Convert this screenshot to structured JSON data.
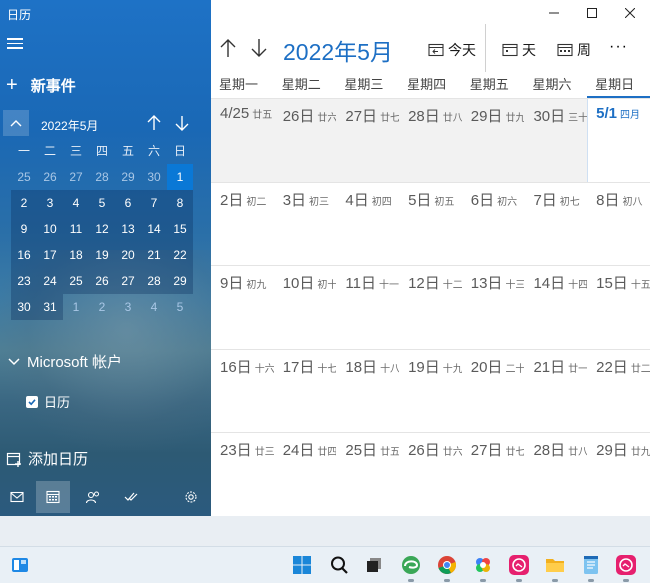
{
  "app": {
    "title": "日历"
  },
  "sidebar": {
    "new_event": "新事件",
    "mini_calendar": {
      "title": "2022年5月",
      "dow": [
        "一",
        "二",
        "三",
        "四",
        "五",
        "六",
        "日"
      ],
      "days": [
        {
          "d": "25",
          "kind": "other"
        },
        {
          "d": "26",
          "kind": "other"
        },
        {
          "d": "27",
          "kind": "other"
        },
        {
          "d": "28",
          "kind": "other"
        },
        {
          "d": "29",
          "kind": "other"
        },
        {
          "d": "30",
          "kind": "other"
        },
        {
          "d": "1",
          "kind": "today"
        },
        {
          "d": "2",
          "kind": "cur"
        },
        {
          "d": "3",
          "kind": "cur"
        },
        {
          "d": "4",
          "kind": "cur"
        },
        {
          "d": "5",
          "kind": "cur"
        },
        {
          "d": "6",
          "kind": "cur"
        },
        {
          "d": "7",
          "kind": "cur"
        },
        {
          "d": "8",
          "kind": "cur"
        },
        {
          "d": "9",
          "kind": "cur"
        },
        {
          "d": "10",
          "kind": "cur"
        },
        {
          "d": "11",
          "kind": "cur"
        },
        {
          "d": "12",
          "kind": "cur"
        },
        {
          "d": "13",
          "kind": "cur"
        },
        {
          "d": "14",
          "kind": "cur"
        },
        {
          "d": "15",
          "kind": "cur"
        },
        {
          "d": "16",
          "kind": "cur"
        },
        {
          "d": "17",
          "kind": "cur"
        },
        {
          "d": "18",
          "kind": "cur"
        },
        {
          "d": "19",
          "kind": "cur"
        },
        {
          "d": "20",
          "kind": "cur"
        },
        {
          "d": "21",
          "kind": "cur"
        },
        {
          "d": "22",
          "kind": "cur"
        },
        {
          "d": "23",
          "kind": "cur"
        },
        {
          "d": "24",
          "kind": "cur"
        },
        {
          "d": "25",
          "kind": "cur"
        },
        {
          "d": "26",
          "kind": "cur"
        },
        {
          "d": "27",
          "kind": "cur"
        },
        {
          "d": "28",
          "kind": "cur"
        },
        {
          "d": "29",
          "kind": "cur"
        },
        {
          "d": "30",
          "kind": "cur"
        },
        {
          "d": "31",
          "kind": "cur"
        },
        {
          "d": "1",
          "kind": "other"
        },
        {
          "d": "2",
          "kind": "other"
        },
        {
          "d": "3",
          "kind": "other"
        },
        {
          "d": "4",
          "kind": "other"
        },
        {
          "d": "5",
          "kind": "other"
        }
      ]
    },
    "account": "Microsoft 帐户",
    "calendar_item": "日历",
    "add_calendar": "添加日历",
    "bottom_nav": [
      "mail-icon",
      "calendar-icon",
      "people-icon",
      "todo-icon",
      "settings-icon"
    ]
  },
  "main": {
    "title": "2022年5月",
    "today_btn": "今天",
    "day_btn": "天",
    "week_btn": "周",
    "more": "···",
    "dow": [
      "星期一",
      "星期二",
      "星期三",
      "星期四",
      "星期五",
      "星期六",
      "星期日"
    ],
    "weeks": [
      [
        {
          "num": "4/25",
          "lunar": "廿五",
          "kind": "other"
        },
        {
          "num": "26日",
          "lunar": "廿六",
          "kind": "other"
        },
        {
          "num": "27日",
          "lunar": "廿七",
          "kind": "other"
        },
        {
          "num": "28日",
          "lunar": "廿八",
          "kind": "other"
        },
        {
          "num": "29日",
          "lunar": "廿九",
          "kind": "other"
        },
        {
          "num": "30日",
          "lunar": "三十",
          "kind": "other"
        },
        {
          "num": "5/1",
          "lunar": "四月",
          "kind": "today"
        }
      ],
      [
        {
          "num": "2日",
          "lunar": "初二",
          "kind": "cur"
        },
        {
          "num": "3日",
          "lunar": "初三",
          "kind": "cur"
        },
        {
          "num": "4日",
          "lunar": "初四",
          "kind": "cur"
        },
        {
          "num": "5日",
          "lunar": "初五",
          "kind": "cur"
        },
        {
          "num": "6日",
          "lunar": "初六",
          "kind": "cur"
        },
        {
          "num": "7日",
          "lunar": "初七",
          "kind": "cur"
        },
        {
          "num": "8日",
          "lunar": "初八",
          "kind": "cur"
        }
      ],
      [
        {
          "num": "9日",
          "lunar": "初九",
          "kind": "cur"
        },
        {
          "num": "10日",
          "lunar": "初十",
          "kind": "cur"
        },
        {
          "num": "11日",
          "lunar": "十一",
          "kind": "cur"
        },
        {
          "num": "12日",
          "lunar": "十二",
          "kind": "cur"
        },
        {
          "num": "13日",
          "lunar": "十三",
          "kind": "cur"
        },
        {
          "num": "14日",
          "lunar": "十四",
          "kind": "cur"
        },
        {
          "num": "15日",
          "lunar": "十五",
          "kind": "cur"
        }
      ],
      [
        {
          "num": "16日",
          "lunar": "十六",
          "kind": "cur"
        },
        {
          "num": "17日",
          "lunar": "十七",
          "kind": "cur"
        },
        {
          "num": "18日",
          "lunar": "十八",
          "kind": "cur"
        },
        {
          "num": "19日",
          "lunar": "十九",
          "kind": "cur"
        },
        {
          "num": "20日",
          "lunar": "二十",
          "kind": "cur"
        },
        {
          "num": "21日",
          "lunar": "廿一",
          "kind": "cur"
        },
        {
          "num": "22日",
          "lunar": "廿二",
          "kind": "cur"
        }
      ],
      [
        {
          "num": "23日",
          "lunar": "廿三",
          "kind": "cur"
        },
        {
          "num": "24日",
          "lunar": "廿四",
          "kind": "cur"
        },
        {
          "num": "25日",
          "lunar": "廿五",
          "kind": "cur"
        },
        {
          "num": "26日",
          "lunar": "廿六",
          "kind": "cur"
        },
        {
          "num": "27日",
          "lunar": "廿七",
          "kind": "cur"
        },
        {
          "num": "28日",
          "lunar": "廿八",
          "kind": "cur"
        },
        {
          "num": "29日",
          "lunar": "廿九",
          "kind": "cur"
        }
      ]
    ]
  },
  "taskbar": {
    "items": [
      "widgets-icon",
      "start-icon",
      "search-icon",
      "task-view-icon",
      "edge-icon",
      "chrome-icon",
      "app-icon",
      "app-icon-pink",
      "file-explorer-icon",
      "notepad-icon",
      "app-icon-pink-2"
    ]
  },
  "colors": {
    "accent": "#1d6fc4",
    "today_fill": "#0a78d6"
  }
}
